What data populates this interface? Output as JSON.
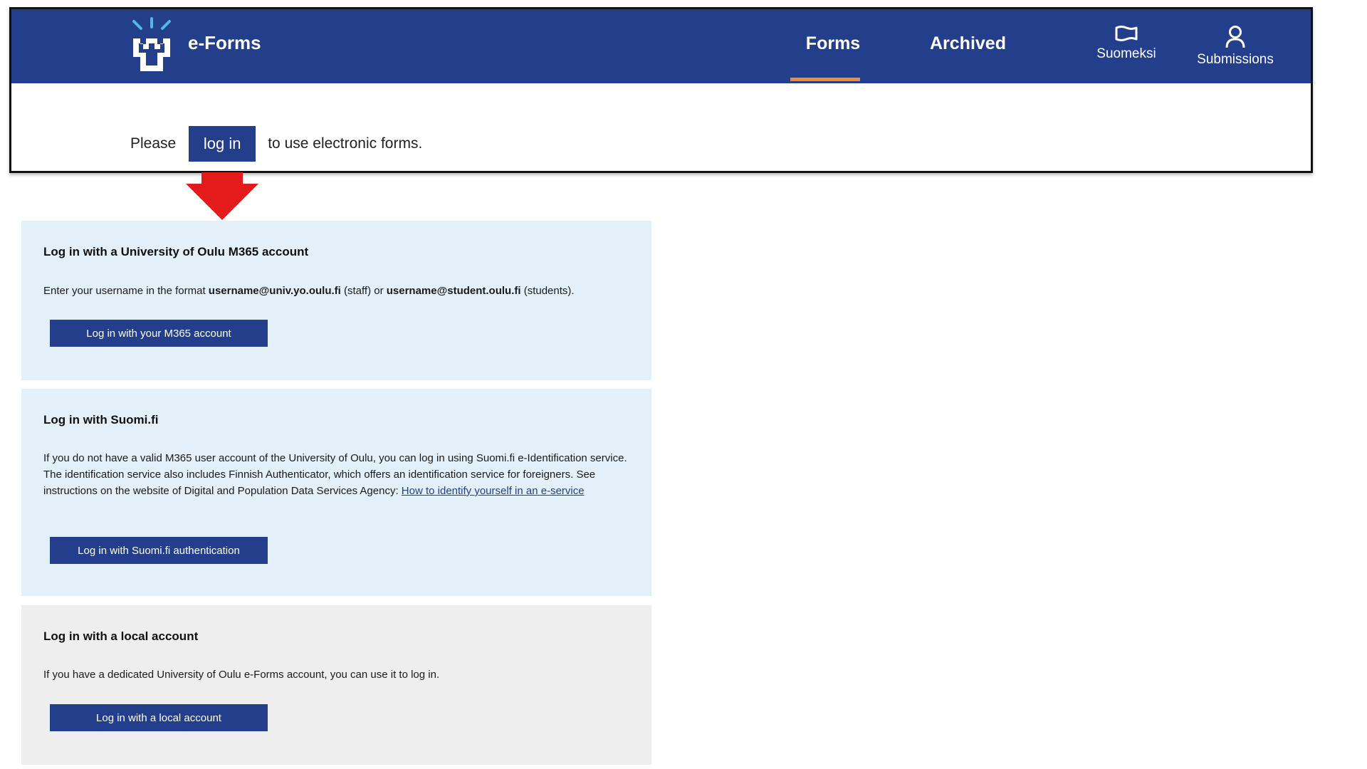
{
  "header": {
    "brand": "e-Forms",
    "nav": {
      "forms": "Forms",
      "archived": "Archived"
    },
    "language": "Suomeksi",
    "submissions": "Submissions"
  },
  "notice": {
    "prefix": "Please",
    "button": "log in",
    "suffix": "to use electronic forms."
  },
  "panels": {
    "m365": {
      "title": "Log in with a University of Oulu M365 account",
      "text_1": "Enter your username in the format ",
      "staff_format": "username@univ.yo.oulu.fi",
      "text_2": " (staff) or ",
      "student_format": "username@student.oulu.fi",
      "text_3": " (students).",
      "button": "Log in with your M365 account"
    },
    "suomi": {
      "title": "Log in with Suomi.fi",
      "text": "If you do not have a valid M365 user account of the University of Oulu, you can log in using Suomi.fi e-Identification service. The identification service also includes Finnish Authenticator, which offers an identification service for foreigners. See instructions on the website of Digital and Population Data Services Agency: ",
      "link": "How to identify yourself in an e-service",
      "button": "Log in with Suomi.fi authentication"
    },
    "local": {
      "title": "Log in with a local account",
      "text": "If you have a dedicated University of Oulu e-Forms account, you can use it to log in.",
      "button": "Log in with a local account"
    }
  },
  "colors": {
    "brand_blue": "#233f8c",
    "nav_active": "#f28b30",
    "arrow_red": "#e31b1b",
    "panel_blue": "#e4f0f9",
    "panel_grey": "#eeeeee"
  }
}
